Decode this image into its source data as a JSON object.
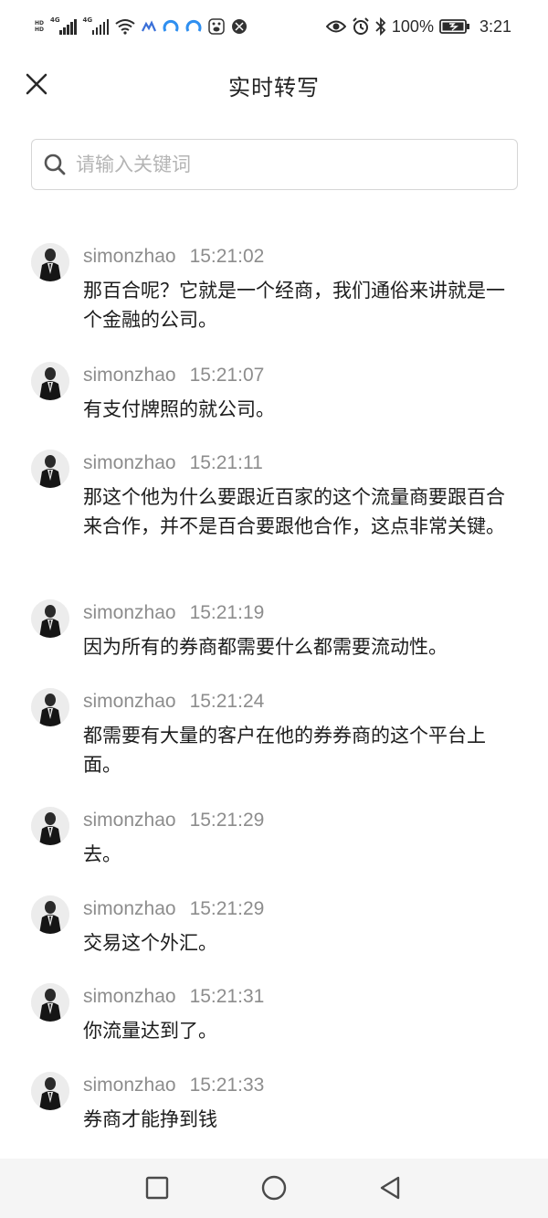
{
  "status_bar": {
    "sim1_type": "4G",
    "sim2_type": "4G",
    "battery_percent": "100%",
    "time": "3:21",
    "icons": [
      "hd-icon",
      "signal-icon",
      "signal-icon",
      "wifi-icon",
      "app-icon",
      "app-icon",
      "app-icon",
      "baidu-icon",
      "app-icon",
      "eye-icon",
      "alarm-icon",
      "bluetooth-icon",
      "battery-icon"
    ]
  },
  "header": {
    "title": "实时转写",
    "close_icon": "close-icon"
  },
  "search": {
    "placeholder": "请输入关键词",
    "value": ""
  },
  "transcript": [
    {
      "speaker": "simonzhao",
      "time": "15:21:02",
      "text": "那百合呢？它就是一个经商，我们通俗来讲就是一个金融的公司。"
    },
    {
      "speaker": "simonzhao",
      "time": "15:21:07",
      "text": "有支付牌照的就公司。"
    },
    {
      "speaker": "simonzhao",
      "time": "15:21:11",
      "text": "那这个他为什么要跟近百家的这个流量商要跟百合来合作，并不是百合要跟他合作，这点非常关键。"
    },
    {
      "speaker": "simonzhao",
      "time": "15:21:19",
      "text": "因为所有的券商都需要什么都需要流动性。"
    },
    {
      "speaker": "simonzhao",
      "time": "15:21:24",
      "text": "都需要有大量的客户在他的券券商的这个平台上面。"
    },
    {
      "speaker": "simonzhao",
      "time": "15:21:29",
      "text": "去。"
    },
    {
      "speaker": "simonzhao",
      "time": "15:21:29",
      "text": "交易这个外汇。"
    },
    {
      "speaker": "simonzhao",
      "time": "15:21:31",
      "text": "你流量达到了。"
    },
    {
      "speaker": "simonzhao",
      "time": "15:21:33",
      "text": "券商才能挣到钱"
    }
  ],
  "nav_bar": {
    "buttons": [
      "recent-apps-icon",
      "home-icon",
      "back-icon"
    ]
  },
  "colors": {
    "meta_gray": "#8d8d8d",
    "text": "#1d1d1d",
    "border": "#d6d6d6",
    "nav_bg": "#f5f5f5"
  }
}
